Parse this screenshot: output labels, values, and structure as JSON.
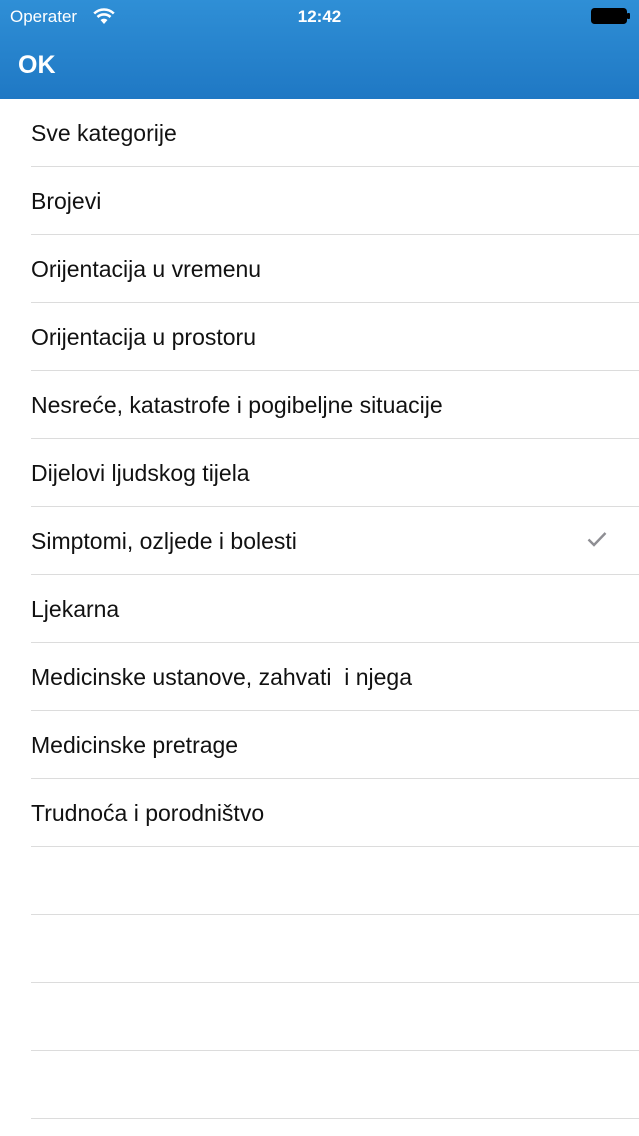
{
  "status_bar": {
    "carrier": "Operater",
    "time": "12:42",
    "icons": [
      "wifi-icon",
      "battery-icon"
    ]
  },
  "nav": {
    "ok_label": "OK"
  },
  "colors": {
    "nav_bar": "#2684cd",
    "separator": "#dcdcdc",
    "checkmark": "#8e8e93"
  },
  "categories": {
    "items": [
      {
        "label": "Sve kategorije",
        "selected": false
      },
      {
        "label": "Brojevi",
        "selected": false
      },
      {
        "label": "Orijentacija u vremenu",
        "selected": false
      },
      {
        "label": "Orijentacija u prostoru",
        "selected": false
      },
      {
        "label": "Nesreće, katastrofe i pogibeljne situacije",
        "selected": false
      },
      {
        "label": "Dijelovi ljudskog tijela",
        "selected": false
      },
      {
        "label": "Simptomi, ozljede i bolesti",
        "selected": true
      },
      {
        "label": "Ljekarna",
        "selected": false
      },
      {
        "label": "Medicinske ustanove, zahvati  i njega",
        "selected": false
      },
      {
        "label": "Medicinske pretrage",
        "selected": false
      },
      {
        "label": "Trudnoća i porodništvo",
        "selected": false
      }
    ],
    "empty_rows": 4
  }
}
